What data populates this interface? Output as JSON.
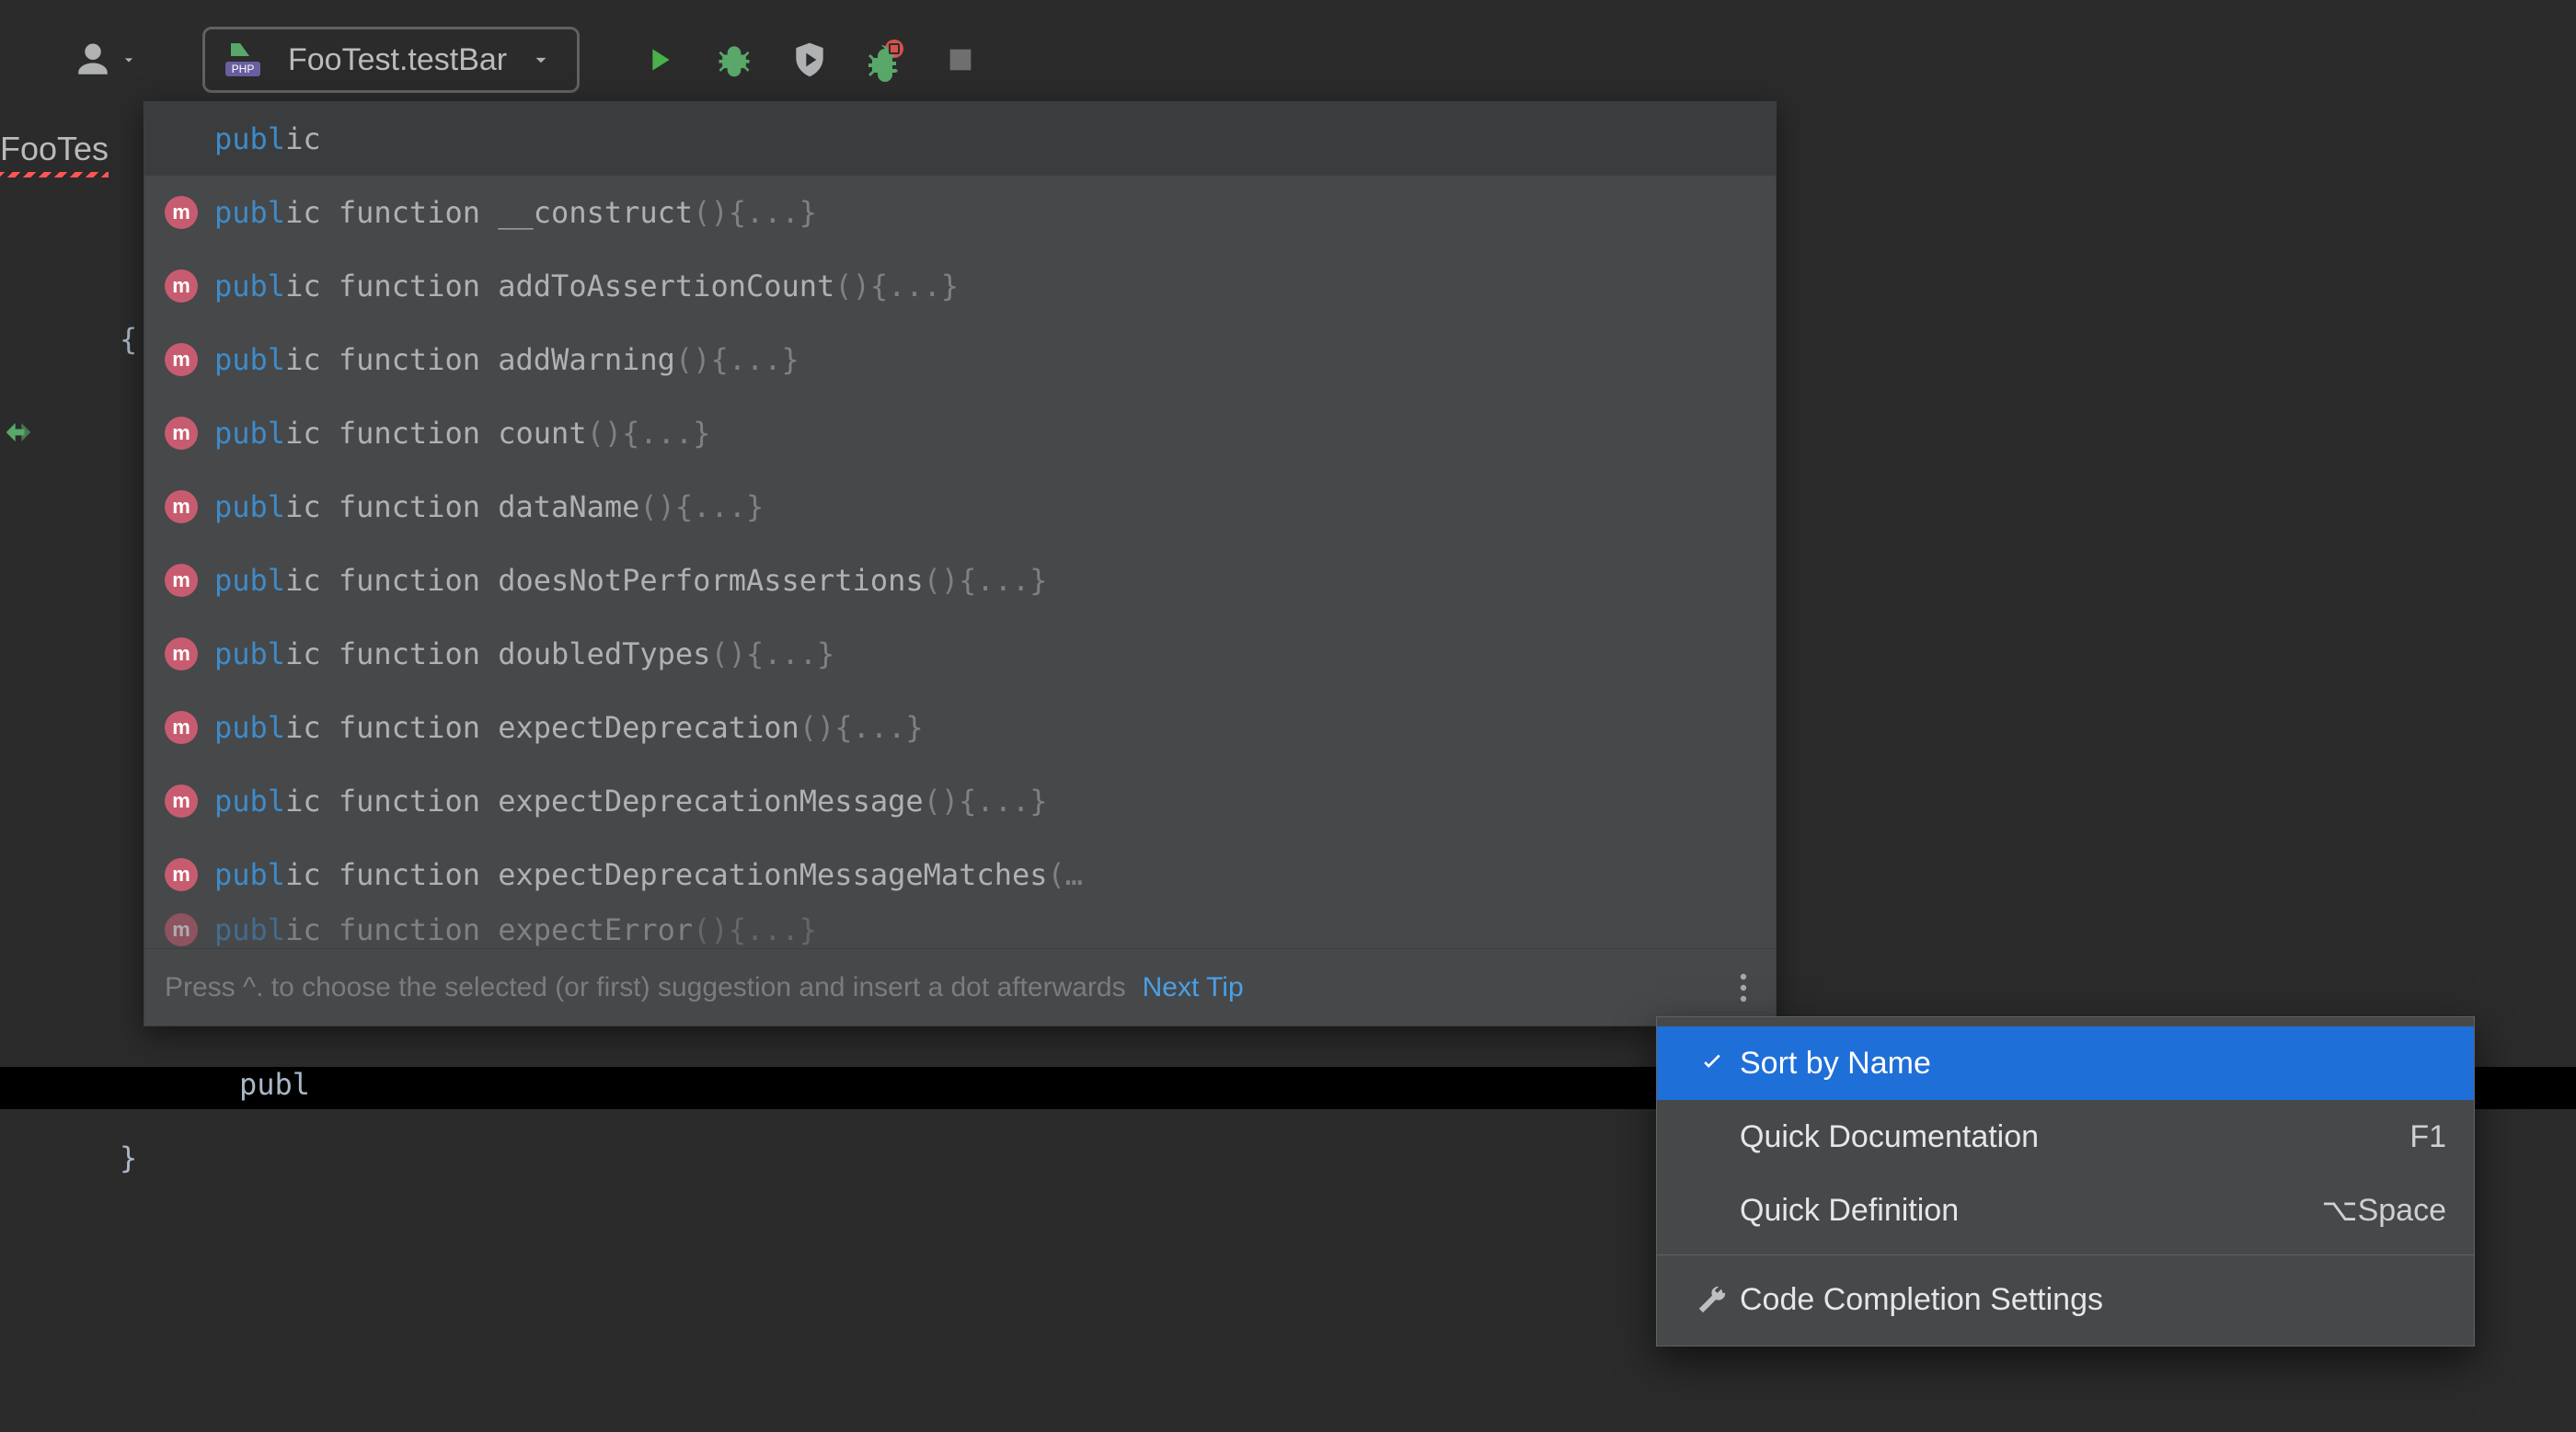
{
  "toolbar": {
    "run_config_label": "FooTest.testBar"
  },
  "editor": {
    "tab_label": "FooTes",
    "brace_open": "{",
    "brace_close": "}",
    "typed_text": "publ"
  },
  "completion": {
    "query_match": "publ",
    "query_rest": "ic",
    "items": [
      {
        "kw": "publ",
        "kw_rest": "ic",
        "mid": " function ",
        "name": "__construct",
        "sig": "(){...}"
      },
      {
        "kw": "publ",
        "kw_rest": "ic",
        "mid": " function ",
        "name": "addToAssertionCount",
        "sig": "(){...}"
      },
      {
        "kw": "publ",
        "kw_rest": "ic",
        "mid": " function ",
        "name": "addWarning",
        "sig": "(){...}"
      },
      {
        "kw": "publ",
        "kw_rest": "ic",
        "mid": " function ",
        "name": "count",
        "sig": "(){...}"
      },
      {
        "kw": "publ",
        "kw_rest": "ic",
        "mid": " function ",
        "name": "dataName",
        "sig": "(){...}"
      },
      {
        "kw": "publ",
        "kw_rest": "ic",
        "mid": " function ",
        "name": "doesNotPerformAssertions",
        "sig": "(){...}"
      },
      {
        "kw": "publ",
        "kw_rest": "ic",
        "mid": " function ",
        "name": "doubledTypes",
        "sig": "(){...}"
      },
      {
        "kw": "publ",
        "kw_rest": "ic",
        "mid": " function ",
        "name": "expectDeprecation",
        "sig": "(){...}"
      },
      {
        "kw": "publ",
        "kw_rest": "ic",
        "mid": " function ",
        "name": "expectDeprecationMessage",
        "sig": "(){...}"
      },
      {
        "kw": "publ",
        "kw_rest": "ic",
        "mid": " function ",
        "name": "expectDeprecationMessageMatches",
        "sig": "(…"
      },
      {
        "kw": "publ",
        "kw_rest": "ic",
        "mid": " function ",
        "name": "expectError",
        "sig": "(){...}"
      }
    ],
    "footer_hint": "Press ^. to choose the selected (or first) suggestion and insert a dot afterwards",
    "footer_tip": "Next Tip",
    "badge_letter": "m"
  },
  "context_menu": {
    "items": [
      {
        "label": "Sort by Name",
        "shortcut": "",
        "checked": true,
        "selected": true,
        "icon": "check"
      },
      {
        "label": "Quick Documentation",
        "shortcut": "F1",
        "checked": false,
        "selected": false
      },
      {
        "label": "Quick Definition",
        "shortcut": "⌥Space",
        "checked": false,
        "selected": false
      }
    ],
    "settings_label": "Code Completion Settings"
  },
  "colors": {
    "accent_blue": "#1f6fd8",
    "keyword_blue": "#3f8bc8",
    "method_badge": "#c75c70",
    "run_green": "#49b04a",
    "debug_green": "#59a869"
  }
}
